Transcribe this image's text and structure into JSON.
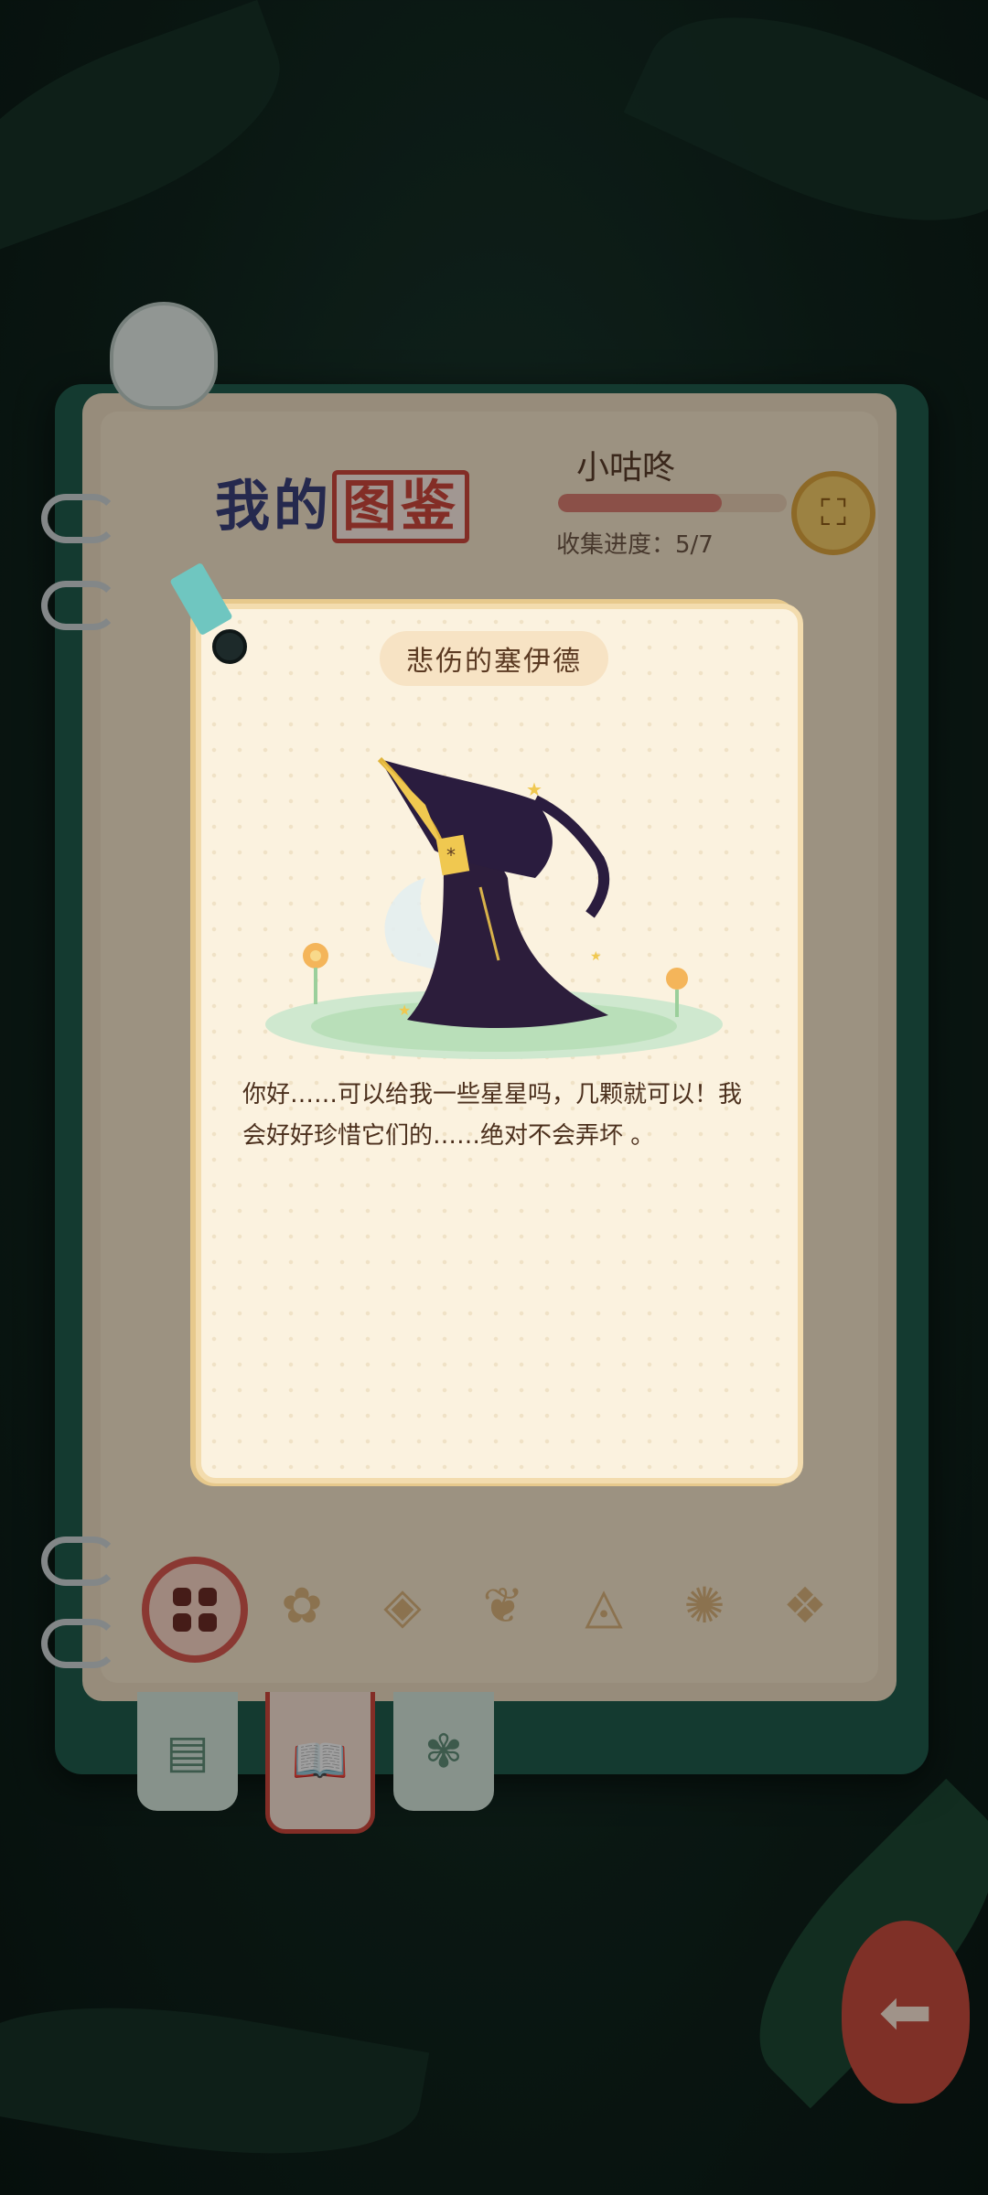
{
  "notebook": {
    "title_part1": "我的",
    "title_highlight": "图鉴",
    "player_name": "小咕咚",
    "progress_label": "收集进度：5/7",
    "progress_fraction": 0.714,
    "badge_icon": "gift-icon"
  },
  "card": {
    "title": "悲伤的塞伊德",
    "dialog": "你好……可以给我一些星星吗，几颗就可以！我会好好珍惜它们的……绝对不会弄坏 。",
    "character": "witch-character-illustration"
  },
  "icon_bar": [
    {
      "name": "grid-category-icon",
      "active": true
    },
    {
      "name": "flower-category-icon",
      "active": false
    },
    {
      "name": "eye-category-icon",
      "active": false
    },
    {
      "name": "leaf-category-icon",
      "active": false
    },
    {
      "name": "snail-category-icon",
      "active": false
    },
    {
      "name": "fan-category-icon",
      "active": false
    },
    {
      "name": "ornament-category-icon",
      "active": false
    }
  ],
  "tabs": [
    {
      "name": "notes-tab-icon",
      "active": false
    },
    {
      "name": "book-tab-icon",
      "active": true
    },
    {
      "name": "flower-tab-icon",
      "active": false
    }
  ],
  "colors": {
    "accent_red": "#c9453b",
    "title_blue": "#3a3f78",
    "card_bg": "#fbf2df",
    "card_border": "#f3dcae"
  }
}
